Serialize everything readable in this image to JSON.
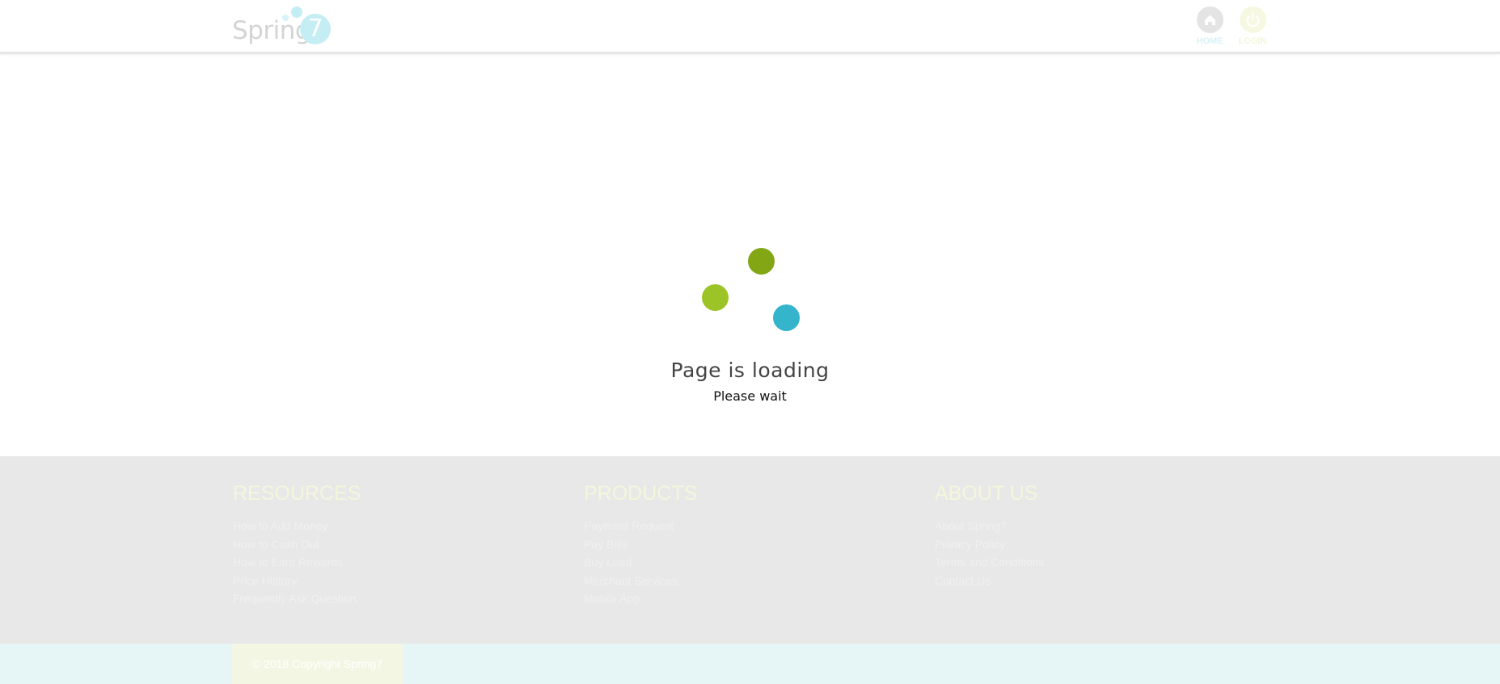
{
  "header": {
    "logo": {
      "text": "Spring",
      "numeral": "7"
    },
    "nav": [
      {
        "label": "HOME",
        "icon": "home-icon"
      },
      {
        "label": "LOGIN",
        "icon": "power-icon"
      }
    ]
  },
  "loader": {
    "title": "Page is loading",
    "subtitle": "Please wait",
    "dot_colors": [
      "#82a614",
      "#9cc426",
      "#34b5cc"
    ]
  },
  "footer": {
    "columns": [
      {
        "heading": "RESOURCES",
        "links": [
          "How to Add Money",
          "How to Cash Out",
          "How to Earn Rewards",
          "Price History",
          "Frequently Ask Question"
        ]
      },
      {
        "heading": "PRODUCTS",
        "links": [
          "Payment Request",
          "Pay Bills",
          "Buy Load",
          "Merchant Services",
          "Mobile App"
        ]
      },
      {
        "heading": "ABOUT US",
        "links": [
          "About Spring7",
          "Privacy Policy",
          "Terms and Conditions",
          "Contact Us"
        ]
      }
    ],
    "copyright": "© 2018 Copyright Spring7"
  }
}
